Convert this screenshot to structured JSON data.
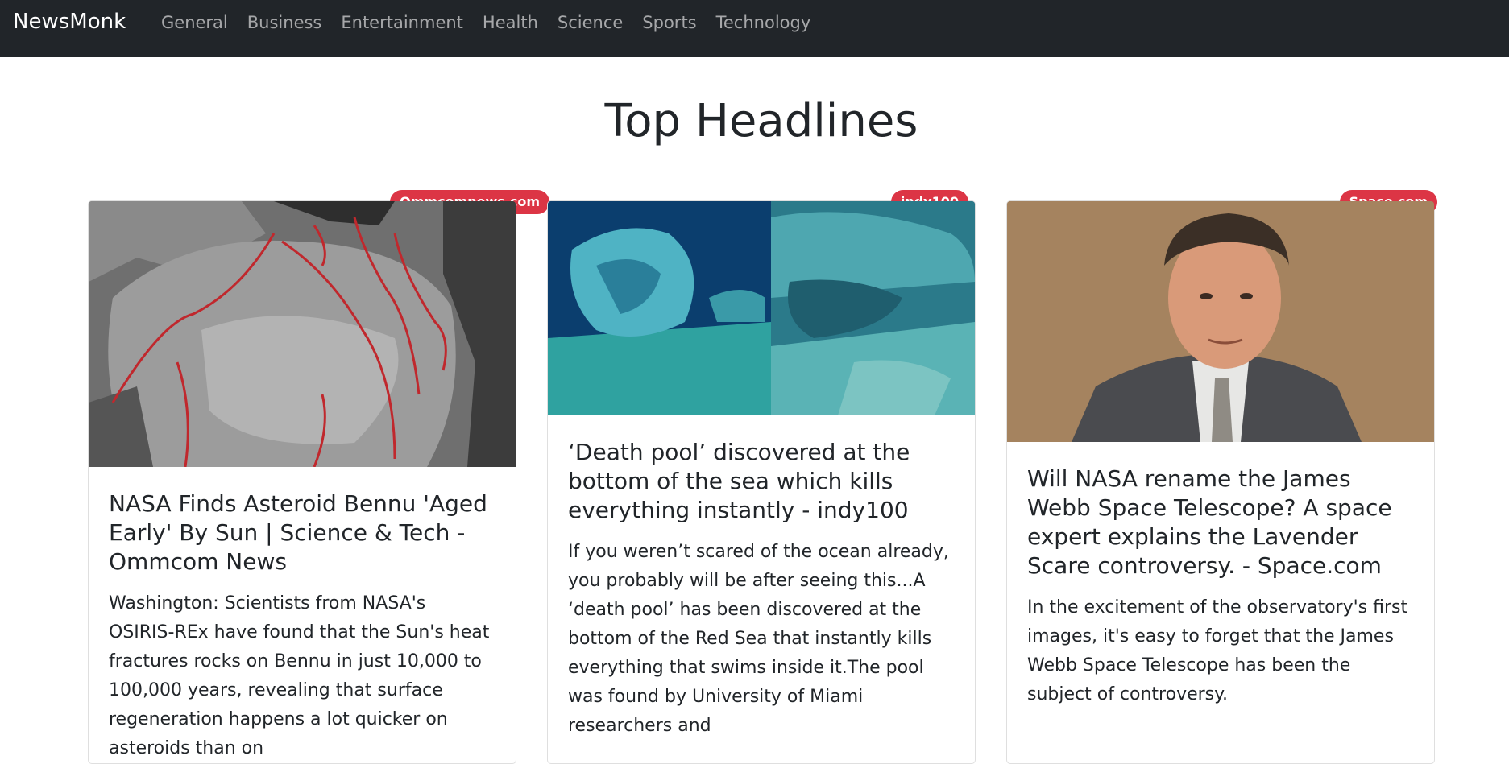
{
  "navbar": {
    "brand": "NewsMonk",
    "links": [
      "General",
      "Business",
      "Entertainment",
      "Health",
      "Science",
      "Sports",
      "Technology"
    ]
  },
  "page": {
    "title": "Top Headlines"
  },
  "articles": [
    {
      "source": "Ommcomnews.com",
      "title": "NASA Finds Asteroid Bennu 'Aged Early' By Sun | Science & Tech - Ommcom News",
      "description": "Washington:  Scientists from NASA's OSIRIS-REx have found that the Sun's heat fractures rocks on Bennu in just 10,000 to 100,000 years, revealing that surface regeneration happens a lot quicker on asteroids than on"
    },
    {
      "source": "indy100",
      "title": "‘Death pool’ discovered at the bottom of the sea which kills everything instantly - indy100",
      "description": "If you weren’t scared of the ocean already, you probably will be after seeing this...A ‘death pool’ has been discovered at the bottom of the Red Sea that instantly kills everything that swims inside it.The pool was found by University of Miami researchers and"
    },
    {
      "source": "Space.com",
      "title": "Will NASA rename the James Webb Space Telescope? A space expert explains the Lavender Scare controversy. - Space.com",
      "description": "In the excitement of the observatory's first images, it's easy to forget that the James Webb Space Telescope has been the subject of controversy."
    }
  ],
  "colors": {
    "navbar": "#212529",
    "badge": "#dc3545",
    "nav_link": "#9a9c9e"
  }
}
